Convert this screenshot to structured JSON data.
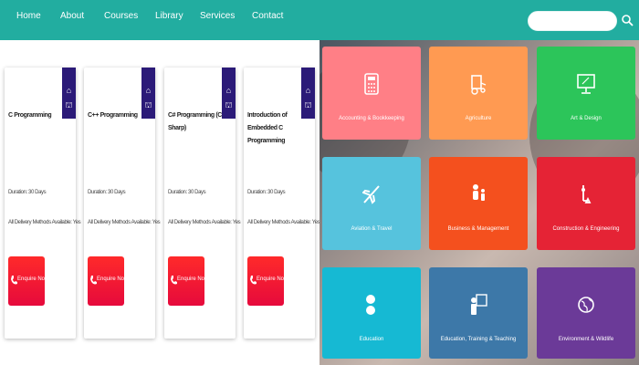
{
  "nav": {
    "items": [
      "Home",
      "About",
      "Courses",
      "Library",
      "Services",
      "Contact"
    ],
    "search_placeholder": ""
  },
  "courses": [
    {
      "title": "C Programming",
      "duration": "Duration: 30 Days",
      "delivery": "All Delivery Methods Available: Yes",
      "button": "Enquire Now"
    },
    {
      "title": "C++ Programming",
      "duration": "Duration: 30 Days",
      "delivery": "All Delivery Methods Available: Yes",
      "button": "Enquire Now"
    },
    {
      "title": "C# Programming (C Sharp)",
      "duration": "Duration: 30 Days",
      "delivery": "All Delivery Methods Available: Yes",
      "button": "Enquire Now"
    },
    {
      "title": "Introduction of Embedded C Programming",
      "duration": "Duration: 30 Days",
      "delivery": "All Delivery Methods Available: Yes",
      "button": "Enquire Now"
    }
  ],
  "categories": [
    {
      "label": "Accounting & Bookkeeping",
      "color": "#ff7f86",
      "icon": "calculator-icon"
    },
    {
      "label": "Agriculture",
      "color": "#ff9a52",
      "icon": "tractor-icon"
    },
    {
      "label": "Art & Design",
      "color": "#2cc55a",
      "icon": "monitor-icon"
    },
    {
      "label": "Aviation & Travel",
      "color": "#56c3dd",
      "icon": "airplane-icon"
    },
    {
      "label": "Business & Management",
      "color": "#f4501e",
      "icon": "people-icon"
    },
    {
      "label": "Construction & Engineering",
      "color": "#e52335",
      "icon": "crane-icon"
    },
    {
      "label": "Education",
      "color": "#16b9d3",
      "icon": "education-icon"
    },
    {
      "label": "Education, Training & Teaching",
      "color": "#3d78a8",
      "icon": "teacher-icon"
    },
    {
      "label": "Environment & Wildlife",
      "color": "#6b3a98",
      "icon": "globe-icon"
    }
  ],
  "colors": {
    "nav": "#22ada0",
    "ribbon": "#2b1a78",
    "enquire": "#f01e32"
  }
}
